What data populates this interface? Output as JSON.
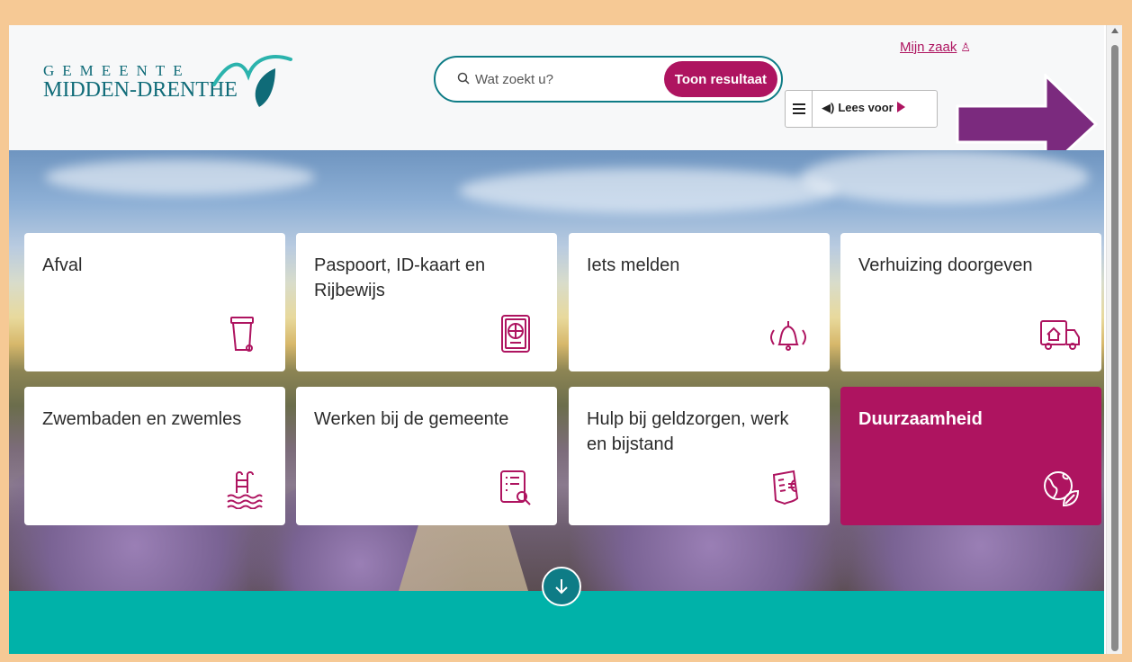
{
  "logo": {
    "line1": "GEMEENTE",
    "line2": "MIDDEN-DRENTHE",
    "color": "#0f6b78"
  },
  "search": {
    "placeholder": "Wat zoekt u?",
    "button_label": "Toon resultaat"
  },
  "account": {
    "label": "Mijn zaak"
  },
  "readspeaker": {
    "label": "Lees voor"
  },
  "tiles": [
    {
      "label": "Afval",
      "icon": "trash-bin-icon"
    },
    {
      "label": "Paspoort, ID-kaart en Rijbewijs",
      "icon": "passport-icon"
    },
    {
      "label": "Iets melden",
      "icon": "bell-ringing-icon"
    },
    {
      "label": "Verhuizing doorgeven",
      "icon": "moving-truck-icon"
    },
    {
      "label": "Zwembaden en zwemles",
      "icon": "pool-ladder-icon"
    },
    {
      "label": "Werken bij de gemeente",
      "icon": "vacancy-document-icon"
    },
    {
      "label": "Hulp bij geldzorgen, werk en bijstand",
      "icon": "euro-receipt-icon"
    },
    {
      "label": "Duurzaamheid",
      "icon": "globe-leaf-icon"
    }
  ],
  "colors": {
    "accent": "#ae1460",
    "teal": "#0e7c86",
    "band": "#00b2a9",
    "annotation_arrow": "#7b2a7e"
  }
}
